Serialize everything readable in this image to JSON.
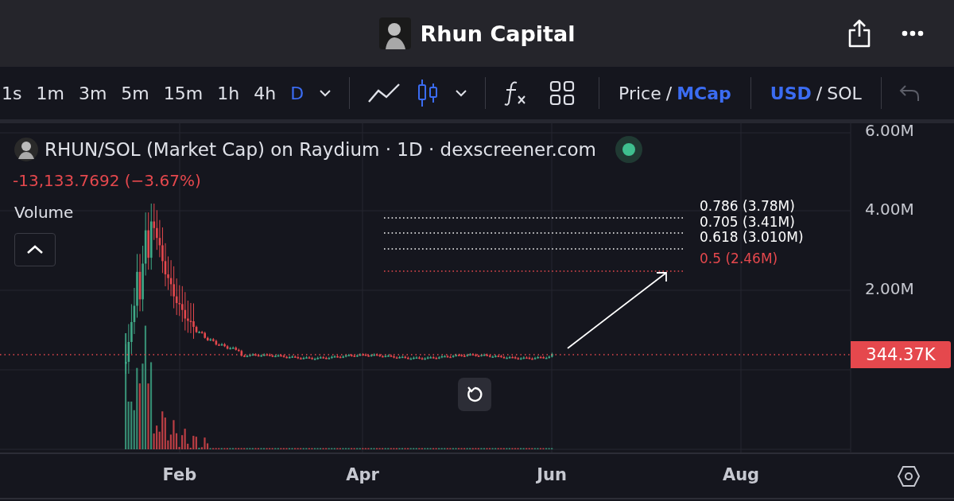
{
  "header": {
    "title": "Rhun Capital"
  },
  "toolbar": {
    "intervals": [
      {
        "label": "1s",
        "selected": false
      },
      {
        "label": "1m",
        "selected": false
      },
      {
        "label": "3m",
        "selected": false
      },
      {
        "label": "5m",
        "selected": false
      },
      {
        "label": "15m",
        "selected": false
      },
      {
        "label": "1h",
        "selected": false
      },
      {
        "label": "4h",
        "selected": false
      },
      {
        "label": "D",
        "selected": true
      }
    ],
    "chart_types": [
      {
        "kind": "line",
        "selected": false
      },
      {
        "kind": "candles",
        "selected": true
      }
    ],
    "value_mode": {
      "separator": "/",
      "options": [
        {
          "label": "Price",
          "selected": false
        },
        {
          "label": "MCap",
          "selected": true
        }
      ]
    },
    "currency": {
      "separator": "/",
      "options": [
        {
          "label": "USD",
          "selected": true
        },
        {
          "label": "SOL",
          "selected": false
        }
      ]
    }
  },
  "chart": {
    "title": "RHUN/SOL (Market Cap) on Raydium · 1D · dexscreener.com",
    "change": "-13,133.7692 (−3.67%)",
    "volume_label": "Volume",
    "fib_levels": [
      {
        "label": "0.786 (3.78M)",
        "color": "#ffffff"
      },
      {
        "label": "0.705 (3.41M)",
        "color": "#ffffff"
      },
      {
        "label": "0.618 (3.010M)",
        "color": "#ffffff"
      },
      {
        "label": "0.5 (2.46M)",
        "color": "#e5484d"
      }
    ],
    "y_axis": [
      "6.00M",
      "4.00M",
      "2.00M"
    ],
    "price_badge": "344.37K",
    "x_axis": [
      "Feb",
      "Apr",
      "Jun",
      "Aug"
    ]
  }
}
